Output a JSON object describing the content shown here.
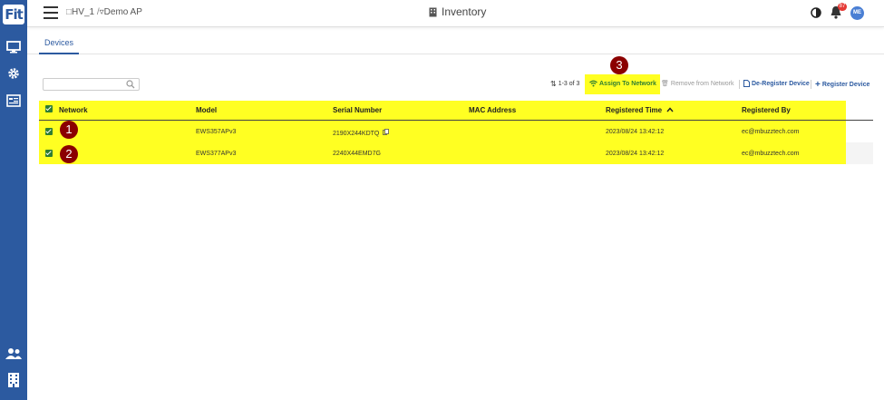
{
  "sidebar": {
    "logo": "Fit",
    "icons": [
      "monitor-icon",
      "gear-icon",
      "list-icon",
      "users-icon",
      "building-icon"
    ]
  },
  "topbar": {
    "breadcrumb_site": "HV_1",
    "breadcrumb_sep": "/",
    "breadcrumb_network": "Demo AP",
    "title": "Inventory",
    "notification_count": "87",
    "avatar_initials": "ME"
  },
  "tabs": [
    {
      "label": "Devices",
      "active": true
    }
  ],
  "search": {
    "placeholder": "",
    "value": ""
  },
  "toolbar": {
    "count": "1-3 of 3",
    "assign_label": "Assign To Network",
    "remove_label": "Remove from Network",
    "deregister_label": "De-Register Device",
    "register_label": "Register Device"
  },
  "callouts": [
    "1",
    "2",
    "3"
  ],
  "table": {
    "headers": [
      "Network",
      "Model",
      "Serial Number",
      "MAC Address",
      "Registered Time",
      "Registered By"
    ],
    "rows": [
      {
        "network": "",
        "model": "EWS357APv3",
        "serial": "2190X244KDTQ",
        "mac": "",
        "time": "2023/08/24 13:42:12",
        "by": "ec@mbuzztech.com"
      },
      {
        "network": "",
        "model": "EWS377APv3",
        "serial": "2240X44EMD7G",
        "mac": "",
        "time": "2023/08/24 13:42:12",
        "by": "ec@mbuzztech.com"
      }
    ]
  },
  "colors": {
    "brand": "#2c5aa0",
    "highlight": "#ffff22",
    "check": "#2e7d32",
    "callout": "#8b0000"
  }
}
